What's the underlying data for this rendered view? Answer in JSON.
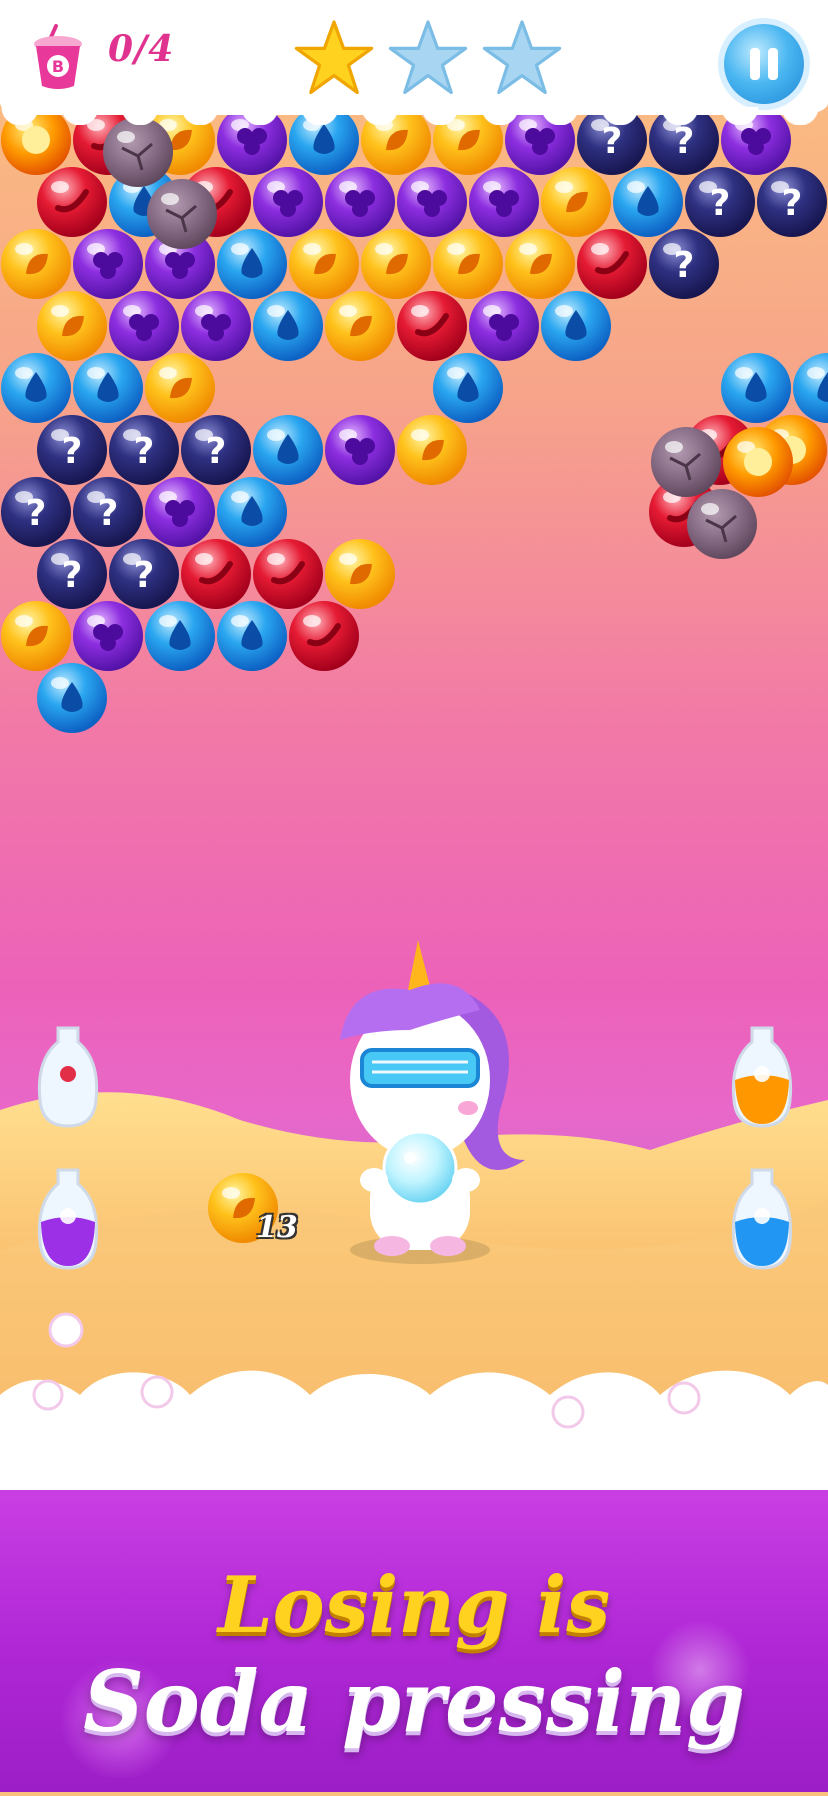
{
  "hud": {
    "goal_counter": "0/4",
    "stars": [
      true,
      false,
      false
    ],
    "drink_icon": "soda-cup-icon",
    "drink_letter": "B",
    "pause_icon": "pause-icon"
  },
  "colors": {
    "orange": "#ffb21c",
    "blue": "#2a9be8",
    "purple": "#8a2bd8",
    "red": "#e01a34",
    "navy": "#2d2d7a",
    "rock": "#8a6e86",
    "fire": "#ff9a00",
    "star_gold": "#ffd21f",
    "star_empty": "#a8d6f2"
  },
  "bubbles": {
    "rows": [
      "F R O P B O O P N N P",
      "R B R P P P P O B N N",
      "O P P B O O O O R N",
      "O P P B O R P B",
      "B B O _ _ _ B _ _ _ B B",
      "N N N B P O _ _ _ R F",
      "N N P B _ _ _ _ _ R",
      "N N R R O",
      "O P B B R",
      "B"
    ]
  },
  "launcher": {
    "current_bubble": "B",
    "next_bubble": "O",
    "shots_left": "13"
  },
  "bottles": [
    {
      "side": "left",
      "fill": "none",
      "item": "chili-icon"
    },
    {
      "side": "right",
      "fill": "#ff9800",
      "item": "lemon-icon"
    },
    {
      "side": "left",
      "fill": "#9b30e6",
      "item": "grape-icon"
    },
    {
      "side": "right",
      "fill": "#2196f3",
      "item": "water-drop-icon"
    }
  ],
  "promo": {
    "line1": "Losing is",
    "line2": "Soda pressing"
  }
}
